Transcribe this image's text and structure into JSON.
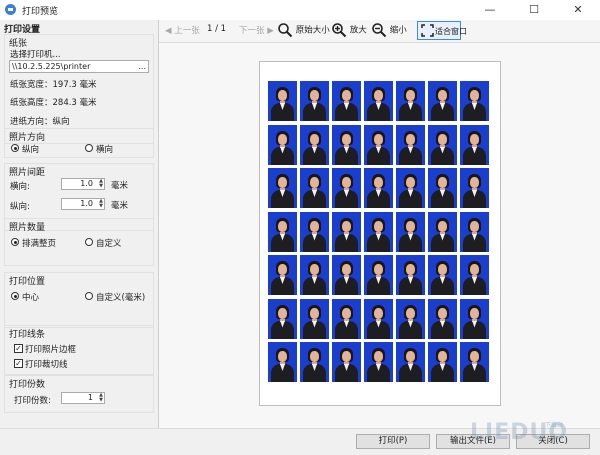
{
  "window": {
    "title": "打印预览",
    "minimize": "—",
    "maximize": "☐",
    "close": "✕"
  },
  "left_panel": {
    "header": "打印设置",
    "paper": {
      "title": "纸张",
      "select_printer_label": "选择打印机...",
      "printer_path": "\\\\10.2.5.225\\printer",
      "browse": "...",
      "width_text": "纸张宽度：197.3 毫米",
      "height_text": "纸张高度：284.3 毫米",
      "feed_text": "进纸方向：纵向"
    },
    "orientation": {
      "title": "照片方向",
      "portrait": "纵向",
      "landscape": "横向",
      "selected": "portrait"
    },
    "spacing": {
      "title": "照片间距",
      "h_label": "横向:",
      "h_value": "1.0",
      "v_label": "纵向:",
      "v_value": "1.0",
      "unit": "毫米"
    },
    "count": {
      "title": "照片数量",
      "fill_page": "排满整页",
      "custom": "自定义",
      "selected": "fill_page"
    },
    "position": {
      "title": "打印位置",
      "center": "中心",
      "custom": "自定义(毫米)",
      "selected": "center"
    },
    "lines": {
      "title": "打印线条",
      "photo_border": "打印照片边框",
      "photo_border_checked": true,
      "cut_lines": "打印裁切线",
      "cut_lines_checked": true
    },
    "copies": {
      "title": "打印份数",
      "label": "打印份数:",
      "value": "1"
    }
  },
  "toolbar": {
    "prev": "上一张",
    "page_indicator": "1 / 1",
    "next": "下一张",
    "original_size": "原始大小",
    "zoom_in": "放大",
    "zoom_out": "缩小",
    "fit_window": "适合窗口"
  },
  "preview": {
    "rows": 7,
    "cols": 7,
    "photo_background": "#1a3fcf"
  },
  "buttons": {
    "print": "打印(P)",
    "export": "输出文件(E)",
    "close": "关闭(C)"
  },
  "watermark": {
    "text": "LIEDUO",
    "sub": "下载站"
  }
}
